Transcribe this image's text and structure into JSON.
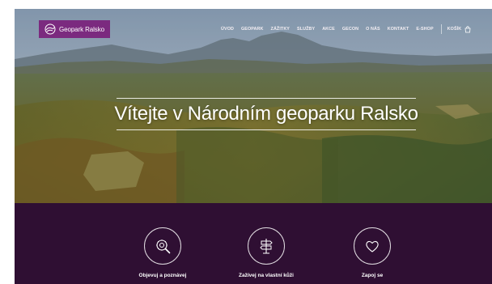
{
  "brand": {
    "name": "Geopark Ralsko",
    "logo_icon": "geopark-logo-icon",
    "accent": "#7b2a7f"
  },
  "nav": {
    "items": [
      {
        "label": "ÚVOD"
      },
      {
        "label": "GEOPARK"
      },
      {
        "label": "ZÁŽITKY"
      },
      {
        "label": "SLUŽBY"
      },
      {
        "label": "AKCE"
      },
      {
        "label": "GECON"
      },
      {
        "label": "O NÁS"
      },
      {
        "label": "KONTAKT"
      },
      {
        "label": "E-SHOP"
      }
    ],
    "cart_label": "KOŠÍK",
    "cart_icon": "cart-icon"
  },
  "hero": {
    "headline": "Vítejte v Národním geoparku Ralsko"
  },
  "features": [
    {
      "label": "Objevuj a poznávej",
      "icon": "magnifier-gear-icon"
    },
    {
      "label": "Zažívej na vlastní kůži",
      "icon": "signpost-icon"
    },
    {
      "label": "Zapoj se",
      "icon": "heart-icon"
    }
  ],
  "colors": {
    "strip_background": "#2f0f33"
  }
}
